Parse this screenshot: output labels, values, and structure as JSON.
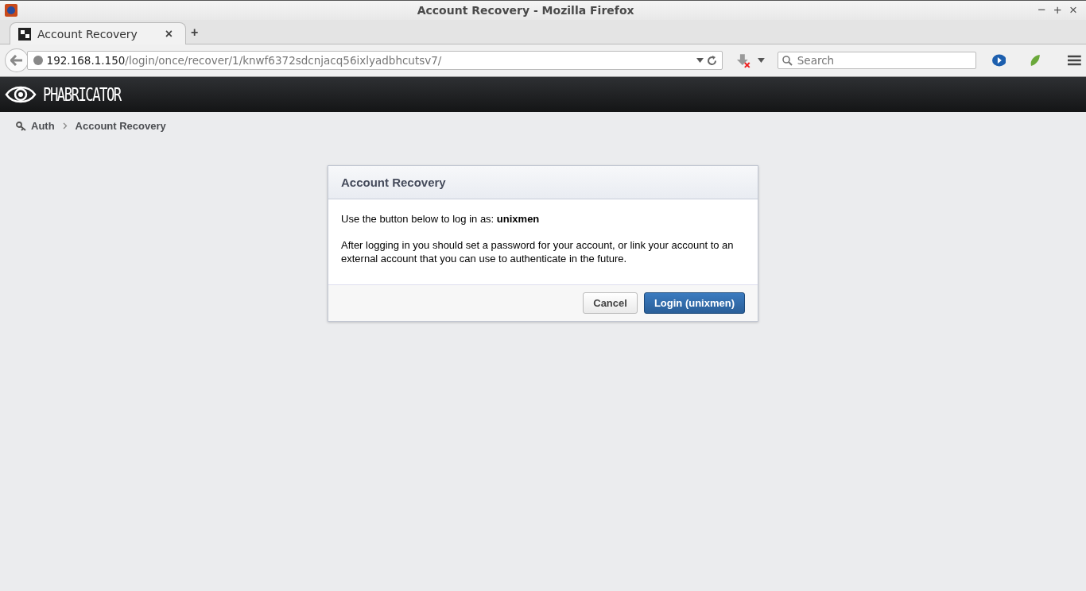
{
  "window": {
    "title": "Account Recovery - Mozilla Firefox",
    "controls": [
      "−",
      "+",
      "×"
    ]
  },
  "tabs": [
    {
      "label": "Account Recovery",
      "selected": true,
      "close": "×"
    }
  ],
  "new_tab": "+",
  "address_bar": {
    "host": "192.168.1.150",
    "path": "/login/once/recover/1/knwf6372sdcnjacq56ixlyadbhcutsv7/"
  },
  "search": {
    "placeholder": "Search"
  },
  "header": {
    "logo": "PHABRICATOR"
  },
  "breadcrumbs": [
    {
      "label": "Auth"
    },
    {
      "label": "Account Recovery"
    }
  ],
  "dialog": {
    "title": "Account Recovery",
    "paragraphs": [
      "Use the button below to log in as: **unixmen**",
      "After logging in you should set a password for your account, or link your account to an external account that you can use to authenticate in the future."
    ],
    "buttons": [
      {
        "label": "Cancel",
        "kind": "secondary"
      },
      {
        "label": "Login (unixmen)",
        "kind": "primary"
      }
    ]
  }
}
